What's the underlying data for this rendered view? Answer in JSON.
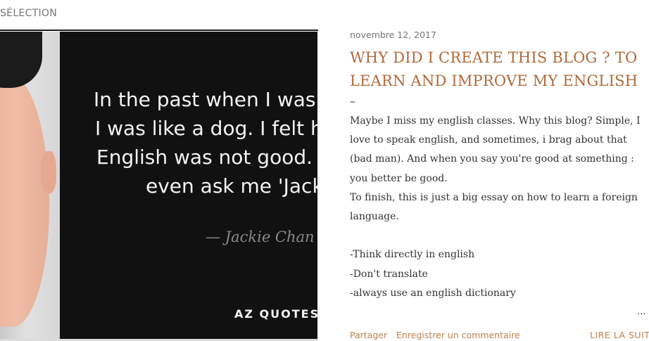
{
  "section": {
    "label": "SÉLECTION"
  },
  "quote_image": {
    "lines": [
      "In the past when I was",
      "I was like a dog. I felt h",
      "English was not good.",
      "even ask me 'Jack"
    ],
    "author": "— Jackie Chan",
    "logo": "AZ QUOTES"
  },
  "post": {
    "date": "novembre 12, 2017",
    "title": "WHY DID I CREATE THIS BLOG ? TO LEARN AND IMPROVE MY ENGLISH",
    "title_dash": "–",
    "body_lines": [
      "Maybe I miss my english classes. Why this blog? Simple, I",
      "love to speak english, and sometimes, i brag about that",
      "(bad man). And when you say you're good at something :",
      "you better be good.",
      "To finish, this is just a big essay on how to learn a foreign",
      "language.",
      "",
      "-Think directly in english",
      "-Don't translate",
      "-always use an english dictionary"
    ],
    "ellipsis": "..."
  },
  "footer": {
    "share_label": "Partager",
    "comment_label": "Enregistrer un commentaire",
    "read_more_label": "LIRE LA SUITE"
  },
  "colors": {
    "title": "#b06a3a",
    "links": "#c0804f",
    "date": "#757575",
    "image_background": "#111111"
  }
}
